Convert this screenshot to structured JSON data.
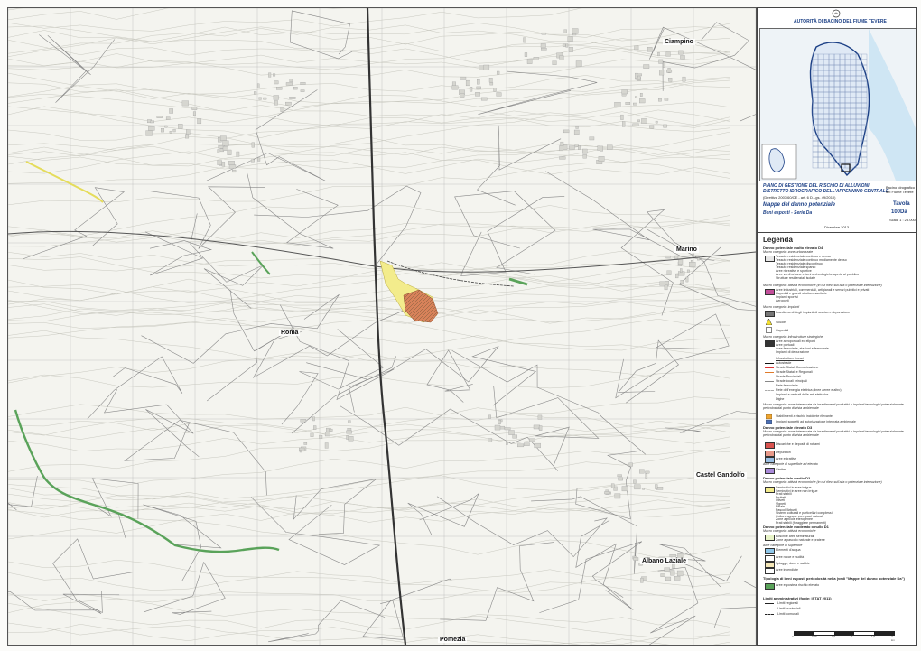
{
  "places": [
    {
      "name": "Ciampino"
    },
    {
      "name": "Marino"
    },
    {
      "name": "Roma"
    },
    {
      "name": "Castel Gandolfo"
    },
    {
      "name": "Albano Laziale"
    },
    {
      "name": "Pomezia"
    }
  ],
  "panel": {
    "authority": "AUTORITÀ DI BACINO DEL FIUME TEVERE",
    "plan_title": "PIANO DI GESTIONE DEL RISCHIO DI ALLUVIONI",
    "district": "DISTRETTO IDROGRAFICO DELL'APPENNINO CENTRALE",
    "directive": "(Direttiva 2007/60/CE - art. 6 D.Lgs. 49/2010)",
    "basin_label": "Bacino idrografico",
    "basin_name": "del Fiume Tevere",
    "maps_title": "Mappe del danno potenziale",
    "series": "Beni esposti - Serie Da",
    "tavola_label": "Tavola",
    "tavola_number": "100Da",
    "scale": "Scala 1 : 25.000",
    "date": "Dicembre 2013"
  },
  "legend": {
    "title": "Legenda",
    "d4": {
      "heading": "Danno potenziale molto elevato D4",
      "cat1": "Macro categoria: zone urbanizzate",
      "cat1_items": [
        "Tessuto residenziale continuo e denso",
        "Tessuto residenziale continuo mediamente denso",
        "Tessuto residenziale discontinuo",
        "Tessuto residenziale sparso",
        "Aree ricreative e sportive",
        "Aree verdi urbane e beni archeologiche aperte al pubblico",
        "Strutture residenziali isolate"
      ],
      "cat2": "Macro categoria: attività economiche (in cui rilevi sull'alta o potenziale interruzione)",
      "cat2_items": [
        "Aree industriali, commerciali, artigianali e servizi pubblici e privati",
        "Ospedali e grandi strutture sanitarie",
        "Impianti sportivi",
        "Aeroporti"
      ],
      "cat3": "Macro categoria: impianti",
      "cat3_items": [
        "Insediamenti degli impianti di scarico e depurazione"
      ],
      "misc": [
        "Scuole",
        "Ospedali"
      ],
      "cat4": "Macro categoria: infrastrutture strategiche",
      "cat4_items": [
        "Aree aeroportuali ed eliporti",
        "Aree portuali",
        "Aree ferroviarie, stazioni e ferroviarie",
        "Impianti di depurazione"
      ],
      "roads_head": "Infrastrutture lineari",
      "roads": [
        "Autostrade",
        "Strade Statali Comunicazione",
        "Strade Statali e Regionali",
        "Strade Provinciali",
        "Strade locali principali",
        "Rete ferroviaria",
        "Rete dell'energia elettrica (linee aeree e altro)",
        "Impianti e centrali delle reti elettriche"
      ],
      "dighe": "Dighe",
      "cat5": "Macro categoria: zone interessate da insediamenti produttivi o impianti tecnologici potenzialmente pericolosi dal punto di vista ambientale",
      "cat5_items": [
        "Stabilimenti a rischio incidente rilevante",
        "Impianti soggetti ad autorizzazione integrata ambientale"
      ]
    },
    "d3": {
      "heading": "Danno potenziale elevato D3",
      "cat": "Macro categoria: zone interessate da insediamenti produttivi o impianti tecnologici potenzialmente pericolosi dal punto di vista ambientale",
      "items": [
        "Discariche e depositi di rottami",
        "Depuratori",
        "Aree estrattive"
      ],
      "cat2": "Altre categorie di superficie ad elevato",
      "cat2_items": [
        "Cimiteri"
      ]
    },
    "d2": {
      "heading": "Danno potenziale medio D2",
      "cat": "Macro categoria: attività economiche (in cui rilevi sull'alta o potenziale interruzione)",
      "items": [
        "Seminativi in aree irrigue",
        "Seminativi in aree non irrigue",
        "Prati stabili",
        "Frutteti",
        "Oliveti",
        "Vigneti",
        "Risaie",
        "Pascoli/Arbusti",
        "Sistemi colturali e particellari complessi",
        "Colture agrarie con spazi naturali",
        "Zone agricole eterogenee",
        "Prati stabili (foraggiere permanenti)"
      ]
    },
    "d1": {
      "heading": "Danno potenziale moderato o nullo D1",
      "cat": "Macro categoria: attività economiche",
      "items": [
        "Boschi e aree seminaturali",
        "Zone a pascolo naturale e praterie"
      ],
      "cat2": "Altre categorie di superficie",
      "cat2_items": [
        "Elementi d'acqua",
        "Aree rocce e nudità",
        "Spiagge, dune e sabbie",
        "Aree incendiate"
      ]
    },
    "tipologia": "Tipologia di beni esposti pericolosità nella (vedi \"Mappe del danno potenziale Da\")",
    "tipologia_items": [
      "Aree esposte a rischio elevato"
    ],
    "limits_head": "Limiti amministrativi (fonte: ISTAT 2011)",
    "limits": [
      "Limiti regionali",
      "Limiti provinciali",
      "Limiti comunali"
    ],
    "scalebar": [
      "0",
      "0,25",
      "0,5",
      "1",
      "1,5",
      "2 km"
    ]
  },
  "colors": {
    "d4_urban": "#e8e8e8",
    "d4_industrial": "#c24f9a",
    "d3": "#d9534f",
    "d2_yellow": "#f3ec8c",
    "d1_green": "#5aa35a",
    "orange_area": "#d8825a",
    "accent": "#1b3f85"
  }
}
